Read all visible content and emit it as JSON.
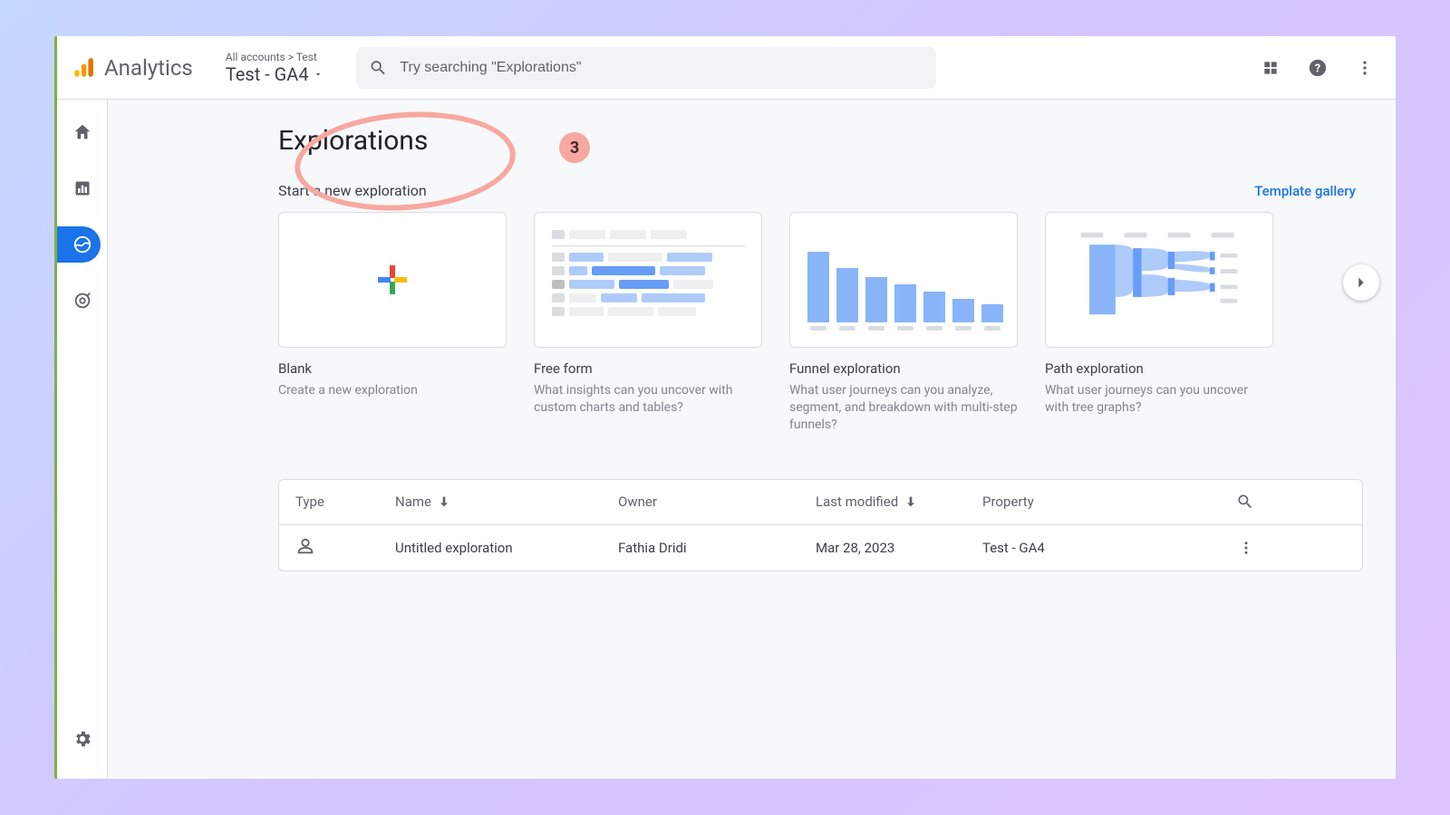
{
  "app": {
    "name": "Analytics"
  },
  "account": {
    "breadcrumb": "All accounts > Test",
    "property": "Test - GA4"
  },
  "search": {
    "placeholder": "Try searching \"Explorations\""
  },
  "annotation": {
    "step": "3"
  },
  "page": {
    "title": "Explorations",
    "subtitle": "Start a new exploration",
    "template_link": "Template gallery"
  },
  "templates": [
    {
      "title": "Blank",
      "desc": "Create a new exploration"
    },
    {
      "title": "Free form",
      "desc": "What insights can you uncover with custom charts and tables?"
    },
    {
      "title": "Funnel exploration",
      "desc": "What user journeys can you analyze, segment, and breakdown with multi-step funnels?"
    },
    {
      "title": "Path exploration",
      "desc": "What user journeys can you uncover with tree graphs?"
    }
  ],
  "table": {
    "headers": {
      "type": "Type",
      "name": "Name",
      "owner": "Owner",
      "last_modified": "Last modified",
      "property": "Property"
    },
    "rows": [
      {
        "name": "Untitled exploration",
        "owner": "Fathia Dridi",
        "last_modified": "Mar 28, 2023",
        "property": "Test - GA4"
      }
    ]
  }
}
